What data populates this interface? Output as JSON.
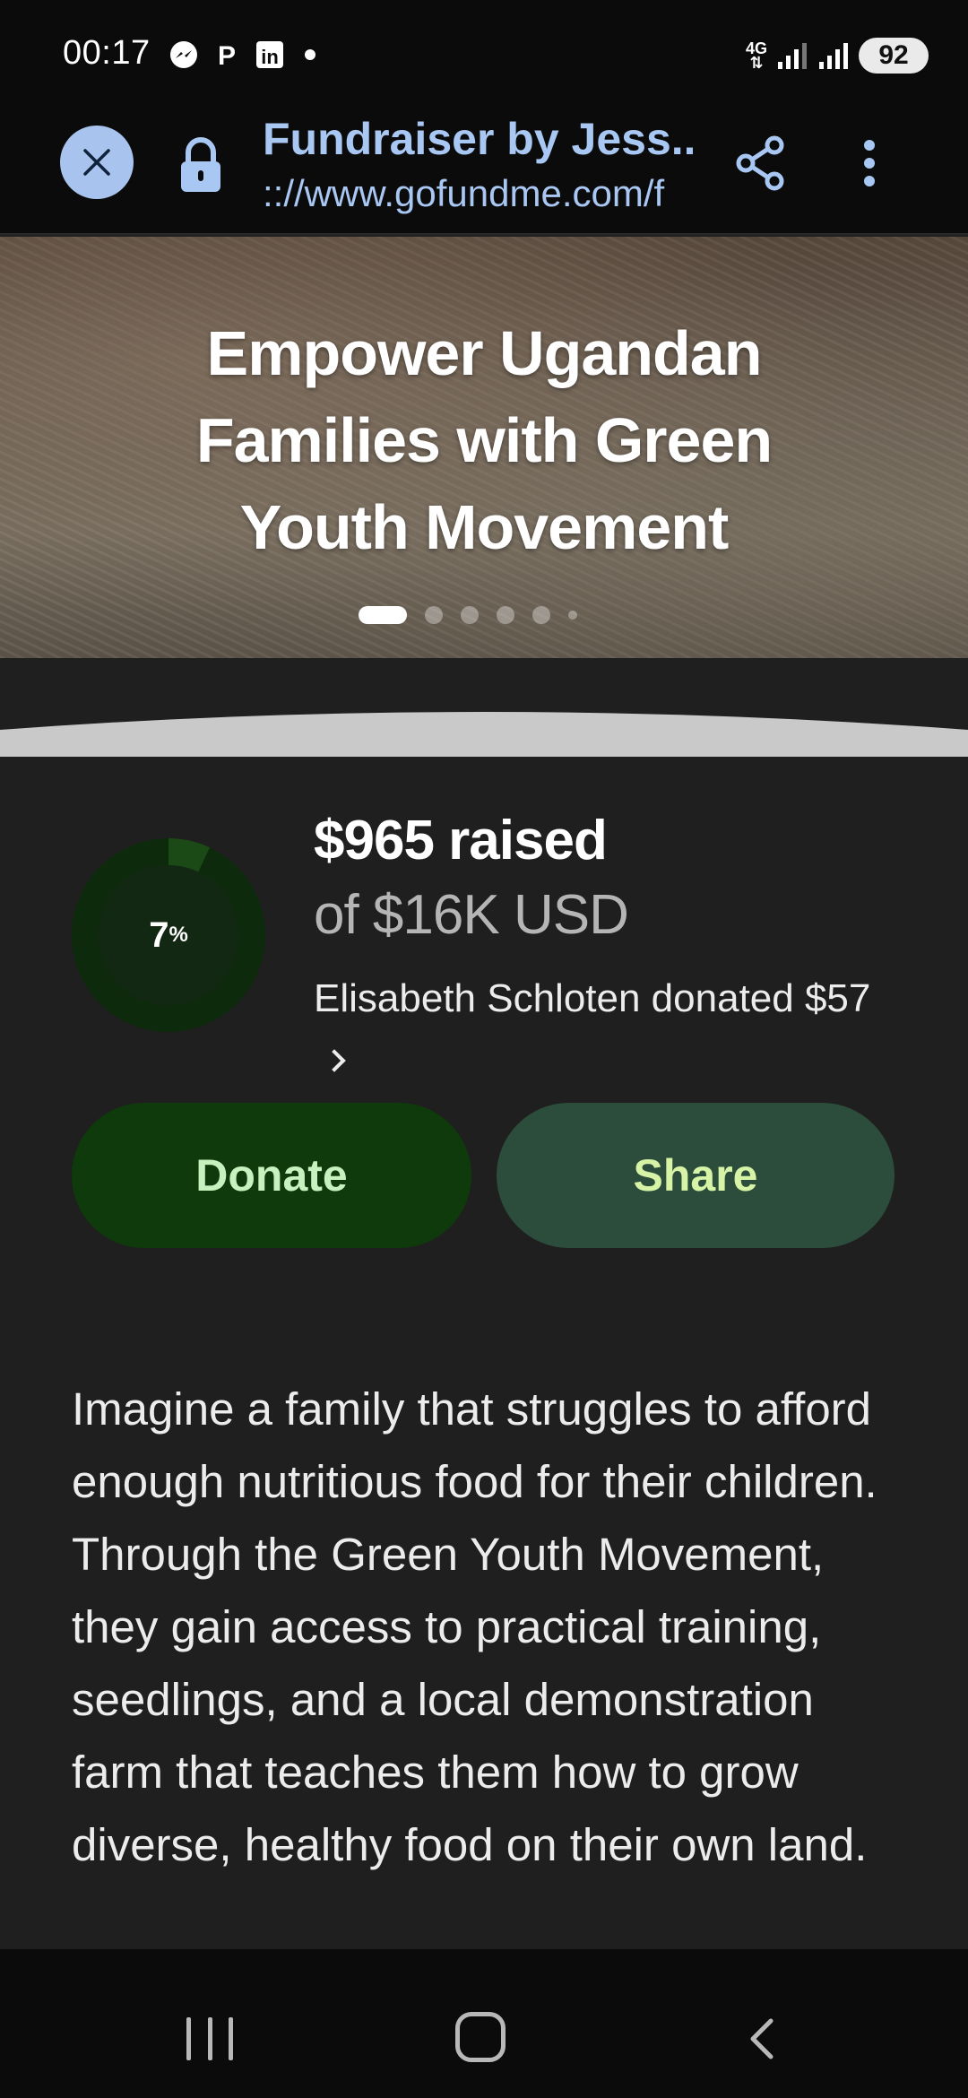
{
  "status_bar": {
    "time": "00:17",
    "network": "4G",
    "battery": "92"
  },
  "browser": {
    "page_title": "Fundraiser by Jess...",
    "url": ":://www.gofundme.com/f"
  },
  "hero": {
    "title_lines": [
      "Empower Ugandan",
      "Families with Green",
      "Youth Movement"
    ]
  },
  "progress": {
    "percent_value": "7",
    "percent_sign": "%",
    "percent_fraction": 0.07,
    "raised": "$965 raised",
    "goal": "of $16K USD",
    "recent_donation": "Elisabeth Schloten donated $57"
  },
  "actions": {
    "donate_label": "Donate",
    "share_label": "Share"
  },
  "story": {
    "text": "Imagine a family that struggles to afford enough nutritious food for their children. Through the Green Youth Movement, they gain access to practical training, seedlings, and a local demonstration farm that teaches them how to grow diverse, healthy food on their own land."
  },
  "colors": {
    "accent_link": "#a9c7f3",
    "donate_bg": "#0f3a0b",
    "share_bg": "#2c4d3b",
    "progress_track": "#0e2a0c"
  }
}
